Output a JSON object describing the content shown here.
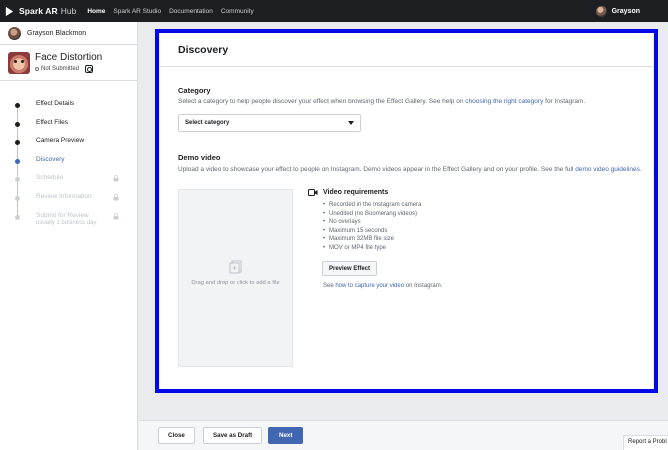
{
  "topnav": {
    "brand": "Spark AR",
    "brand_sub": "Hub",
    "links": [
      "Home",
      "Spark AR Studio",
      "Documentation",
      "Community"
    ],
    "user_name": "Grayson"
  },
  "sidebar": {
    "user_full_name": "Grayson Blackmon",
    "effect_title": "Face Distortion",
    "effect_status": "Not Submitted",
    "steps": [
      {
        "label": "Effect Details",
        "state": "done"
      },
      {
        "label": "Effect Files",
        "state": "done"
      },
      {
        "label": "Camera Preview",
        "state": "done"
      },
      {
        "label": "Discovery",
        "state": "current"
      },
      {
        "label": "Schedule",
        "state": "locked"
      },
      {
        "label": "Review Information",
        "state": "locked"
      },
      {
        "label": "Submit for Review",
        "sub": "usually 1 business day",
        "state": "locked"
      }
    ]
  },
  "main": {
    "title": "Discovery",
    "category": {
      "title": "Category",
      "desc_prefix": "Select a category to help people discover your effect when browsing the Effect Gallery. See help on ",
      "desc_link": "choosing the right category",
      "desc_suffix": " for Instagram.",
      "select_value": "Select category"
    },
    "demo": {
      "title": "Demo video",
      "desc_prefix": "Upload a video to showcase your effect to people on Instagram. Demo videos appear in the Effect Gallery and on your profile. See the full ",
      "desc_link": "demo video guidelines",
      "desc_suffix": ".",
      "dropzone_text": "Drag and drop or click to add a file",
      "req_title": "Video requirements",
      "requirements": [
        "Recorded in the Instagram camera",
        "Unedited (no Boomerang videos)",
        "No overlays",
        "Maximum 15 seconds",
        "Maximum 32MB file size",
        "MOV or MP4 file type"
      ],
      "preview_button": "Preview Effect",
      "foot_prefix": "See ",
      "foot_link": "how to capture your video",
      "foot_suffix": " on Instagram."
    }
  },
  "footer": {
    "close": "Close",
    "save_draft": "Save as Draft",
    "next": "Next",
    "report": "Report a Probl"
  },
  "colors": {
    "accent": "#4267b2",
    "highlight": "#0008e6",
    "nav_bg": "#1c1e21"
  }
}
